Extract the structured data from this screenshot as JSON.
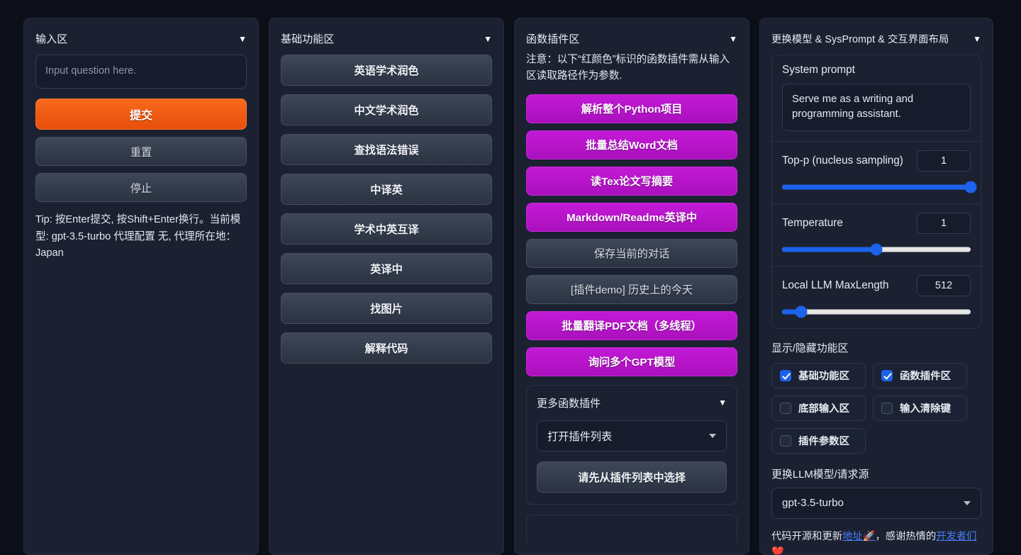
{
  "theme": {
    "page_bg": "#0c0f18",
    "panel_bg": "#1b2131",
    "accent_orange": "#ef5912",
    "accent_magenta": "#b614c9",
    "accent_blue": "#1c62eb",
    "link_blue": "#4a7dfc"
  },
  "input_panel": {
    "title": "输入区",
    "caret": "▼",
    "input_placeholder": "Input question here.",
    "submit_label": "提交",
    "reset_label": "重置",
    "stop_label": "停止",
    "tip": "Tip: 按Enter提交, 按Shift+Enter换行。当前模型: gpt-3.5-turbo 代理配置 无, 代理所在地：Japan"
  },
  "basic_panel": {
    "title": "基础功能区",
    "caret": "▼",
    "buttons": [
      "英语学术润色",
      "中文学术润色",
      "查找语法错误",
      "中译英",
      "学术中英互译",
      "英译中",
      "找图片",
      "解释代码"
    ]
  },
  "plugin_panel": {
    "title": "函数插件区",
    "caret": "▼",
    "notice": "注意：以下“红颜色”标识的函数插件需从输入区读取路径作为参数.",
    "buttons": [
      {
        "label": "解析整个Python项目",
        "style": "magenta"
      },
      {
        "label": "批量总结Word文档",
        "style": "magenta"
      },
      {
        "label": "读Tex论文写摘要",
        "style": "magenta"
      },
      {
        "label": "Markdown/Readme英译中",
        "style": "magenta"
      },
      {
        "label": "保存当前的对话",
        "style": "grey"
      },
      {
        "label": "[插件demo] 历史上的今天",
        "style": "grey"
      },
      {
        "label": "批量翻译PDF文档（多线程）",
        "style": "magenta"
      },
      {
        "label": "询问多个GPT模型",
        "style": "magenta"
      }
    ],
    "more": {
      "title": "更多函数插件",
      "caret": "▼",
      "select_value": "打开插件列表",
      "action_label": "请先从插件列表中选择"
    }
  },
  "settings_panel": {
    "title": "更换模型 & SysPrompt & 交互界面布局",
    "caret": "▼",
    "system_prompt_label": "System prompt",
    "system_prompt_value": "Serve me as a writing and programming assistant.",
    "sliders": [
      {
        "label": "Top-p (nucleus sampling)",
        "value": "1",
        "percent": 100
      },
      {
        "label": "Temperature",
        "value": "1",
        "percent": 50
      },
      {
        "label": "Local LLM MaxLength",
        "value": "512",
        "percent": 10
      }
    ],
    "toggles_label": "显示/隐藏功能区",
    "toggles": [
      {
        "label": "基础功能区",
        "checked": true
      },
      {
        "label": "函数插件区",
        "checked": true
      },
      {
        "label": "底部输入区",
        "checked": false
      },
      {
        "label": "输入清除键",
        "checked": false
      },
      {
        "label": "插件参数区",
        "checked": false
      }
    ],
    "model_label": "更换LLM模型/请求源",
    "model_value": "gpt-3.5-turbo",
    "footer": {
      "part1": "代码开源和更新",
      "link1": "地址🚀",
      "part2": "，感谢热情的",
      "link2": "开发者们❤️"
    }
  }
}
